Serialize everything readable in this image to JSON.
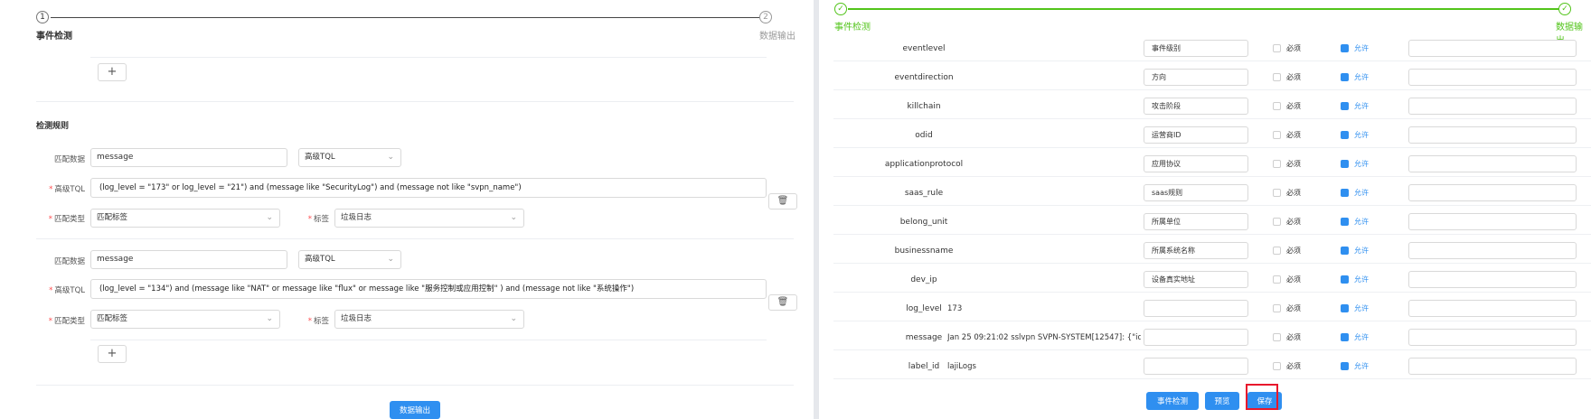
{
  "left": {
    "steps": [
      {
        "number": "1",
        "title": "事件检测"
      },
      {
        "number": "2",
        "title": "数据输出"
      }
    ],
    "add_label": "+",
    "section_title": "检测规则",
    "rules": [
      {
        "match_data_label": "匹配数据",
        "match_data_value": "message",
        "mode_value": "高级TQL",
        "tql_label": "高级TQL",
        "tql_value": "(log_level = \"173\" or log_level = \"21\") and (message like \"SecurityLog\")  and  (message not like \"svpn_name\")",
        "match_type_label": "匹配类型",
        "match_type_value": "匹配标签",
        "tag_label": "标签",
        "tag_value": "垃圾日志"
      },
      {
        "match_data_label": "匹配数据",
        "match_data_value": "message",
        "mode_value": "高级TQL",
        "tql_label": "高级TQL",
        "tql_value": "(log_level = \"134\") and (message like \"NAT\" or message like \"flux\" or message like \"服务控制或应用控制\" )  and  (message not like \"系统操作\")",
        "match_type_label": "匹配类型",
        "match_type_value": "匹配标签",
        "tag_label": "标签",
        "tag_value": "垃圾日志"
      }
    ],
    "next_button": "数据输出"
  },
  "right": {
    "steps": [
      {
        "title": "事件检测"
      },
      {
        "title": "数据输出"
      }
    ],
    "required_label": "必须",
    "allow_label": "允许",
    "rows": [
      {
        "field": "eventlevel",
        "value": "",
        "cn": "事件级别"
      },
      {
        "field": "eventdirection",
        "value": "",
        "cn": "方向"
      },
      {
        "field": "killchain",
        "value": "",
        "cn": "攻击阶段"
      },
      {
        "field": "odid",
        "value": "",
        "cn": "运营商ID"
      },
      {
        "field": "applicationprotocol",
        "value": "",
        "cn": "应用协议"
      },
      {
        "field": "saas_rule",
        "value": "",
        "cn": "saas规则"
      },
      {
        "field": "belong_unit",
        "value": "",
        "cn": "所属单位"
      },
      {
        "field": "businessname",
        "value": "",
        "cn": "所属系统名称"
      },
      {
        "field": "dev_ip",
        "value": "",
        "cn": "设备真实地址"
      },
      {
        "field": "log_level",
        "value": "173",
        "cn": ""
      },
      {
        "field": "message",
        "value": "Jan 25 09:21:02 sslvpn SVPN-SYSTEM[12547]: {\"id\":\"...",
        "cn": ""
      },
      {
        "field": "label_id",
        "value": "lajiLogs",
        "cn": ""
      }
    ],
    "buttons": {
      "detect": "事件检测",
      "preview": "预览",
      "save": "保存"
    }
  }
}
